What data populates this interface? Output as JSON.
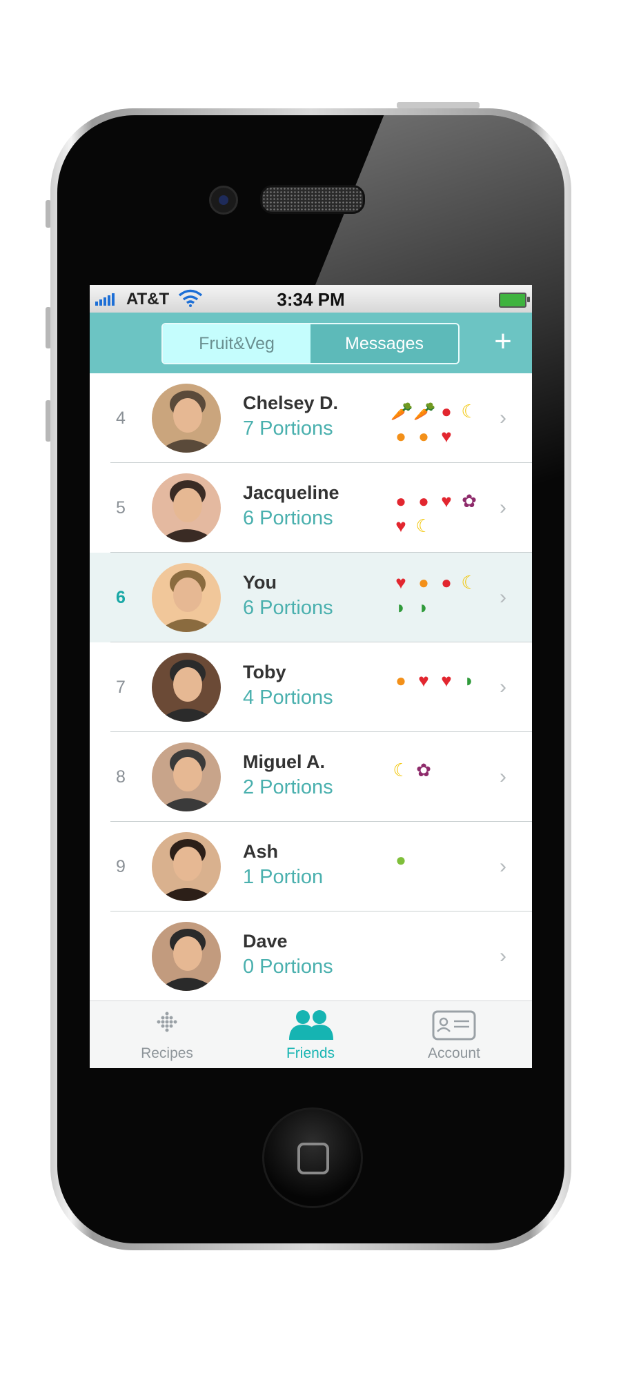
{
  "status_bar": {
    "carrier": "AT&T",
    "time": "3:34 PM",
    "wifi_icon": "wifi-icon",
    "battery_icon": "battery-charging-icon"
  },
  "nav": {
    "segments": [
      "Fruit&Veg",
      "Messages"
    ],
    "active_segment": "Fruit&Veg",
    "add_icon": "plus-icon",
    "accent_color": "#6cc4c3"
  },
  "leaderboard": [
    {
      "rank": "4",
      "name": "Chelsey D.",
      "portions": "7 Portions",
      "fruits": [
        "carrot",
        "carrot",
        "apple",
        "banana",
        "orange",
        "orange",
        "strawberry"
      ]
    },
    {
      "rank": "5",
      "name": "Jacqueline",
      "portions": "6 Portions",
      "fruits": [
        "apple",
        "apple",
        "strawberry",
        "grapes",
        "strawberry",
        "banana"
      ]
    },
    {
      "rank": "6",
      "name": "You",
      "portions": "6 Portions",
      "fruits": [
        "strawberry",
        "orange",
        "apple",
        "banana",
        "watermelon",
        "watermelon"
      ],
      "highlighted": true
    },
    {
      "rank": "7",
      "name": "Toby",
      "portions": "4 Portions",
      "fruits": [
        "orange",
        "strawberry",
        "strawberry",
        "watermelon"
      ]
    },
    {
      "rank": "8",
      "name": "Miguel A.",
      "portions": "2 Portions",
      "fruits": [
        "banana",
        "grapes"
      ]
    },
    {
      "rank": "9",
      "name": "Ash",
      "portions": "1 Portion",
      "fruits": [
        "pear"
      ]
    },
    {
      "rank": "",
      "name": "Dave",
      "portions": "0 Portions",
      "fruits": []
    }
  ],
  "tabbar": {
    "tabs": [
      {
        "label": "Recipes",
        "icon": "dots-icon",
        "active": false
      },
      {
        "label": "Friends",
        "icon": "friends-icon",
        "active": true
      },
      {
        "label": "Account",
        "icon": "id-card-icon",
        "active": false
      }
    ]
  }
}
